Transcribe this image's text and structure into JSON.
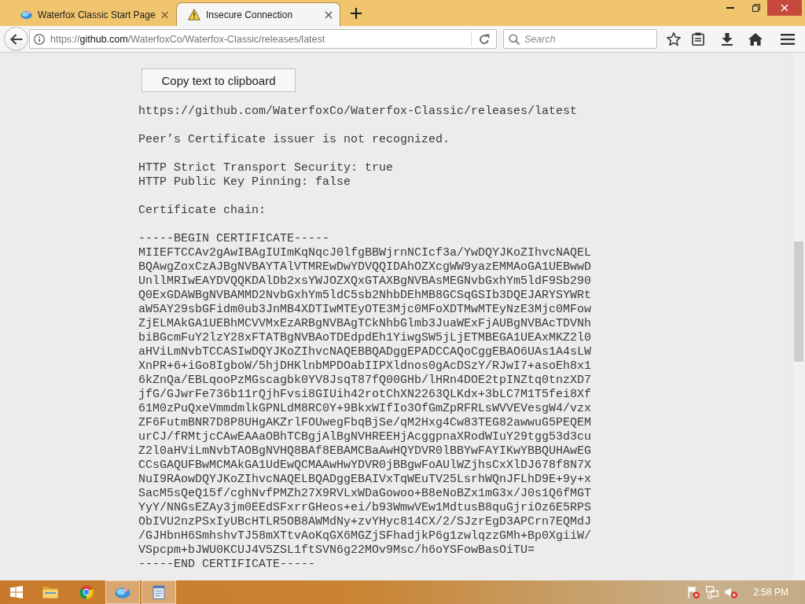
{
  "tabs": [
    {
      "title": "Waterfox Classic Start Page",
      "kind": "start_page",
      "selected": false
    },
    {
      "title": "Insecure Connection",
      "kind": "warning",
      "selected": true
    }
  ],
  "navbar": {
    "address": {
      "scheme": "https://",
      "host": "github.com",
      "path": "/WaterfoxCo/Waterfox-Classic/releases/latest"
    },
    "search": {
      "placeholder": "Search"
    },
    "bookmarked": false
  },
  "page": {
    "copy_button": "Copy text to clipboard",
    "url": "https://github.com/WaterfoxCo/Waterfox-Classic/releases/latest",
    "issuer_message": "Peer’s Certificate issuer is not recognized.",
    "security": [
      "HTTP Strict Transport Security: true",
      "HTTP Public Key Pinning: false"
    ],
    "chain_heading": "Certificate chain:",
    "certificate": {
      "begin": "-----BEGIN CERTIFICATE-----",
      "lines": [
        "MIIEFTCCAv2gAwIBAgIUImKqNqcJ0lfgBBWjrnNCIcf3a/YwDQYJKoZIhvcNAQEL",
        "BQAwgZoxCzAJBgNVBAYTAlVTMREwDwYDVQQIDAhOZXcgWW9yazEMMAoGA1UEBwwD",
        "UnllMRIwEAYDVQQKDAlDb2xsYWJOZXQxGTAXBgNVBAsMEGNvbGxhYm5ldF9Sb290",
        "Q0ExGDAWBgNVBAMMD2NvbGxhYm5ldC5sb2NhbDEhMB8GCSqGSIb3DQEJARYSYWRt",
        "aW5AY29sbGFidm0ub3JnMB4XDTIwMTEyOTE3Mjc0MFoXDTMwMTEyNzE3Mjc0MFow",
        "ZjELMAkGA1UEBhMCVVMxEzARBgNVBAgTCkNhbGlmb3JuaWExFjAUBgNVBAcTDVNh",
        "biBGcmFuY2lzY28xFTATBgNVBAoTDEdpdEh1YiwgSW5jLjETMBEGA1UEAxMKZ2l0",
        "aHViLmNvbTCCASIwDQYJKoZIhvcNAQEBBQADggEPADCCAQoCggEBAO6UAs1A4sLW",
        "XnPR+6+iGo8IgboW/5hjDHKlnbMPDOabIIPXldnos0gAcDSzY/RJwI7+asoEh8x1",
        "6kZnQa/EBLqooPzMGscagbk0YV8JsqT87fQ00GHb/lHRn4DOE2tpINZtq0tnzXD7",
        "jfG/GJwrFe736b11rQjhFvsi8GIUih42rotChXN2263QLKdx+3bLC7M1T5fei8Xf",
        "61M0zPuQxeVmmdmlkGPNLdM8RC0Y+9BkxWIfIo3OfGmZpRFRLsWVVEVesgW4/vzx",
        "ZF6FutmBNR7D8P8UHgAKZrlFOUwegFbqBjSe/qM2Hxg4Cw83TEG82awwuG5PEQEM",
        "urCJ/fRMtjcCAwEAAaOBhTCBgjAlBgNVHREEHjAcggpnaXRodWIuY29tgg53d3cu",
        "Z2l0aHViLmNvbTAOBgNVHQ8BAf8EBAMCBaAwHQYDVR0lBBYwFAYIKwYBBQUHAwEG",
        "CCsGAQUFBwMCMAkGA1UdEwQCMAAwHwYDVR0jBBgwFoAUlWZjhsCxXlDJ678f8N7X",
        "NuI9RAowDQYJKoZIhvcNAQELBQADggEBAIVxTqWEuTV25LsrhWQnJFLhD9E+9y+x",
        "SacM5sQeQ15f/cghNvfPMZh27X9RVLxWDaGowoo+B8eNoBZx1mG3x/J0s1Q6fMGT",
        "YyY/NNGsEZAy3jm0EEdSFxrrGHeos+ei/b93WmwVEw1MdtusB8quGjriOz6E5RPS",
        "ObIVU2nzPSxIyUBcHTLR5OB8AWMdNy+zvYHyc814CX/2/SJzrEgD3APCrn7EQMdJ",
        "/GJHbnH6SmhshvTJ58mXTtvAoKqGX6MGZjSFhadjkP6g1zwlqzzGMh+Bp0XgiiW/",
        "VSpcpm+bJWU0KCUJ4V5ZSL1ftSVN6g22MOv9Msc/h6oYSFowBasOiTU="
      ],
      "end": "-----END CERTIFICATE-----"
    }
  },
  "taskbar": {
    "apps": [
      {
        "kind": "folder",
        "running": false
      },
      {
        "kind": "round_browser",
        "running": false
      },
      {
        "kind": "browser",
        "running": true
      },
      {
        "kind": "notepad",
        "running": true
      }
    ],
    "tray": {
      "alert": true,
      "muted": true,
      "clock": "2:58 PM"
    }
  }
}
